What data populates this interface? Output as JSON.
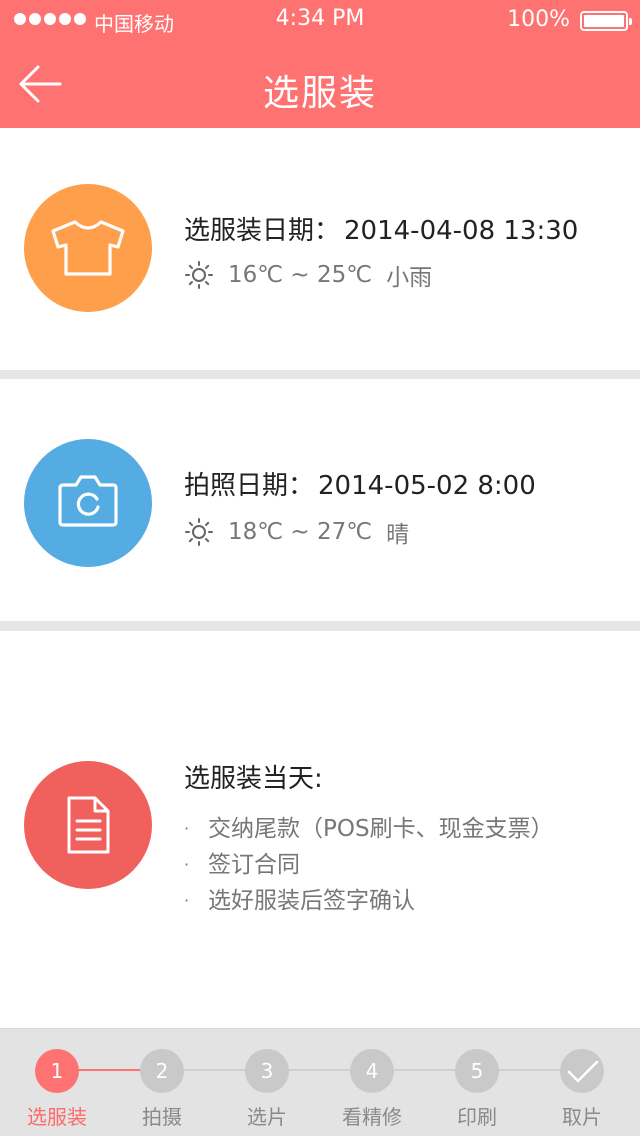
{
  "colors": {
    "accent": "#ff7272",
    "orange": "#ff9f4b",
    "blue": "#55ace2",
    "red": "#f0605c"
  },
  "status_bar": {
    "carrier": "中国移动",
    "time": "4:34 PM",
    "battery": "100%"
  },
  "nav": {
    "title": "选服装"
  },
  "cards": [
    {
      "icon": "tshirt-icon",
      "date_label": "选服装日期：",
      "date_value": "2014-04-08 13:30",
      "temperature": "16℃ ~ 25℃",
      "condition": "小雨"
    },
    {
      "icon": "camera-icon",
      "date_label": "拍照日期：",
      "date_value": "2014-05-02 8:00",
      "temperature": "18℃ ~ 27℃",
      "condition": "晴"
    }
  ],
  "day_card": {
    "icon": "document-icon",
    "title": "选服装当天:",
    "items": [
      "交纳尾款（POS刷卡、现金支票）",
      "签订合同",
      "选好服装后签字确认"
    ]
  },
  "steps": [
    {
      "num": "1",
      "label": "选服装",
      "active": true
    },
    {
      "num": "2",
      "label": "拍摄",
      "active": false
    },
    {
      "num": "3",
      "label": "选片",
      "active": false
    },
    {
      "num": "4",
      "label": "看精修",
      "active": false
    },
    {
      "num": "5",
      "label": "印刷",
      "active": false
    },
    {
      "num": "",
      "label": "取片",
      "icon": "checkmark-icon",
      "active": false
    }
  ]
}
